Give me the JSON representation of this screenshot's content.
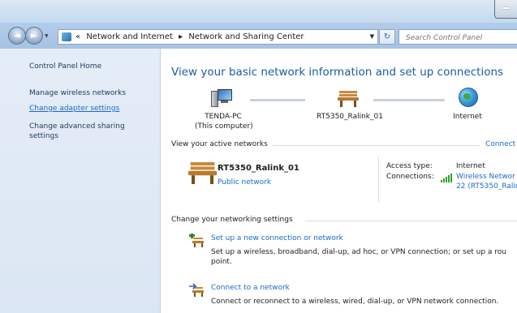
{
  "window": {
    "search_placeholder": "Search Control Panel"
  },
  "address_bar": {
    "overflow": "«",
    "crumbs": [
      "Network and Internet",
      "Network and Sharing Center"
    ],
    "separator": "▸"
  },
  "left_pane": {
    "home": "Control Panel Home",
    "items": [
      "Manage wireless networks",
      "Change adapter settings",
      "Change advanced sharing settings"
    ]
  },
  "main": {
    "heading": "View your basic network information and set up connections",
    "map": {
      "computer_name": "TENDA-PC",
      "computer_sub": "(This computer)",
      "network_name": "RT5350_Ralink_01",
      "internet_label": "Internet"
    },
    "active_section": {
      "title": "View your active networks",
      "link": "Connect",
      "network_name": "RT5350_Ralink_01",
      "network_type": "Public network",
      "access_type_label": "Access type:",
      "access_type_value": "Internet",
      "connections_label": "Connections:",
      "connections_value_line1": "Wireless Networ",
      "connections_value_line2": "22 (RT5350_Ralir"
    },
    "settings_section": {
      "title": "Change your networking settings",
      "tasks": [
        {
          "title": "Set up a new connection or network",
          "desc": "Set up a wireless, broadband, dial-up, ad hoc, or VPN connection; or set up a rou point."
        },
        {
          "title": "Connect to a network",
          "desc": "Connect or reconnect to a wireless, wired, dial-up, or VPN network connection."
        }
      ]
    }
  },
  "colors": {
    "link": "#1b6ac8",
    "heading": "#1e5aa8",
    "left_pane_bg": "#dbe6f4"
  }
}
